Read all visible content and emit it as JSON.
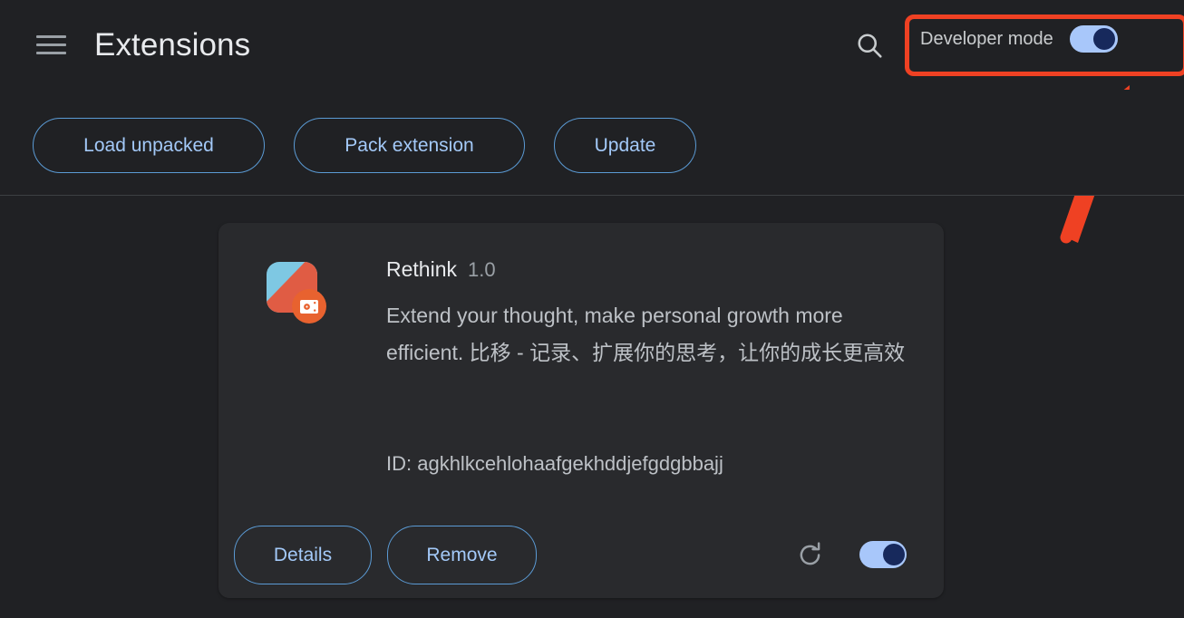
{
  "window": {
    "background_color": "#202124",
    "card_color": "#292a2d"
  },
  "toolbar": {
    "menu_icon": "hamburger-menu-icon",
    "title": "Extensions",
    "search_icon": "search-icon",
    "developer_mode": {
      "label": "Developer mode",
      "toggle_state": "on",
      "toggle_track_color": "#a8c7fa",
      "toggle_knob_color": "#17295c"
    }
  },
  "annotations": {
    "highlight_box_color": "#ef4123",
    "arrow_color": "#ef4123",
    "highlight_target": "developer-mode-toggle"
  },
  "actionbar": {
    "buttons": [
      {
        "label": "Load unpacked",
        "name": "load-unpacked-button"
      },
      {
        "label": "Pack extension",
        "name": "pack-extension-button"
      },
      {
        "label": "Update",
        "name": "update-button"
      }
    ],
    "accent_color": "#a3c9f8"
  },
  "extension_card": {
    "icon_name": "rethink-extension-icon",
    "icon_colors": {
      "primary": "#7ec8e3",
      "secondary": "#e05c44",
      "badge": "#e8622f"
    },
    "badge_icon": "unpacked-extension-badge-icon",
    "name": "Rethink",
    "version": "1.0",
    "description": "Extend your thought, make personal growth more efficient. 比移 - 记录、扩展你的思考，让你的成长更高效",
    "id_label": "ID: agkhlkcehlohaafgekhddjefgdgbbajj",
    "footer": {
      "details_label": "Details",
      "remove_label": "Remove",
      "reload_icon": "reload-icon",
      "enable_toggle_state": "on"
    }
  }
}
